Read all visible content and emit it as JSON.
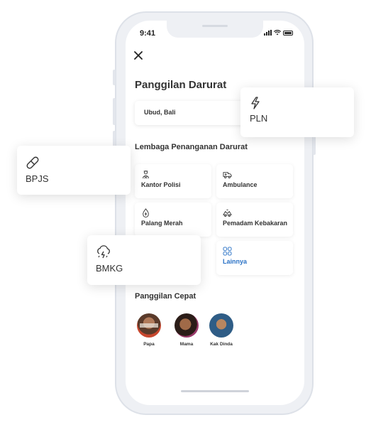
{
  "status_bar": {
    "time": "9:41"
  },
  "header": {
    "title": "Panggilan Darurat"
  },
  "location": {
    "value": "Ubud, Bali"
  },
  "agencies": {
    "heading": "Lembaga Penanganan Darurat",
    "items": [
      {
        "label": "Kantor Polisi",
        "icon": "police-icon"
      },
      {
        "label": "Ambulance",
        "icon": "ambulance-icon"
      },
      {
        "label": "Palang Merah",
        "icon": "red-cross-icon"
      },
      {
        "label": "Pemadam Kebakaran",
        "icon": "fire-truck-icon"
      },
      {
        "label": "Lainnya",
        "icon": "grid-icon"
      }
    ]
  },
  "quick_calls": {
    "heading": "Panggilan Cepat",
    "contacts": [
      {
        "name": "Papa"
      },
      {
        "name": "Mama"
      },
      {
        "name": "Kak Dinda"
      }
    ]
  },
  "floating_cards": {
    "pln": {
      "label": "PLN",
      "icon": "lightning-icon"
    },
    "bpjs": {
      "label": "BPJS",
      "icon": "pill-icon"
    },
    "bmkg": {
      "label": "BMKG",
      "icon": "storm-cloud-icon"
    }
  },
  "colors": {
    "accent": "#2a72c6",
    "text": "#333333"
  }
}
